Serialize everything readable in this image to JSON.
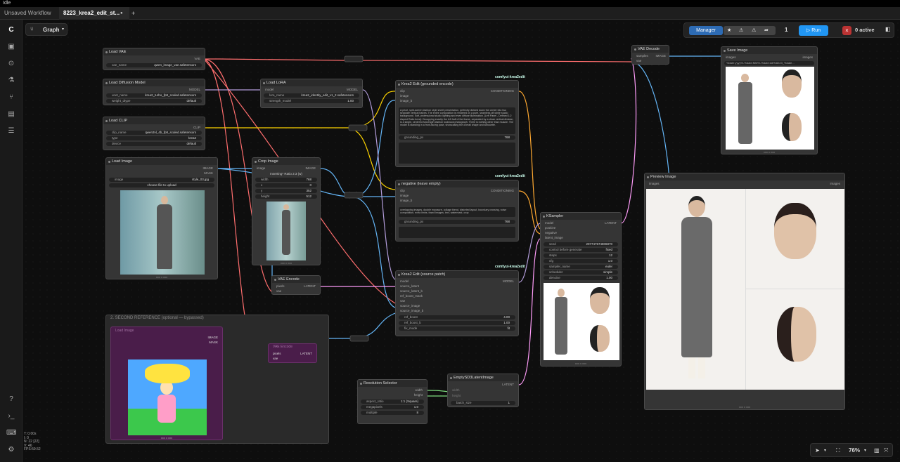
{
  "window_title": "Idle",
  "tabs": [
    {
      "label": "Unsaved Workflow"
    },
    {
      "label": "8223_krea2_edit_st..."
    }
  ],
  "tab_add_label": "+",
  "tab_dot": "●",
  "toolbar": {
    "graph_label": "Graph",
    "manager_label": "Manager",
    "queue_count": "1",
    "run_label": "Run",
    "active_label": "0 active"
  },
  "nodes": {
    "load_vae": {
      "title": "Load VAE",
      "out_vae": "VAE",
      "w_name": "vae_name",
      "w_value": "qwen_image_vae.safetensors"
    },
    "load_diffusion": {
      "title": "Load Diffusion Model",
      "out": "MODEL",
      "w1_name": "unet_name",
      "w1_value": "krea2_turbo_fp8_scaled.safetensors",
      "w2_name": "weight_dtype",
      "w2_value": "default"
    },
    "load_clip": {
      "title": "Load CLIP",
      "out": "CLIP",
      "w1_name": "clip_name",
      "w1_value": "qwen3vl_4b_fp8_scaled.safetensors",
      "w2_name": "type",
      "w2_value": "krea2",
      "w3_name": "device",
      "w3_value": "default"
    },
    "load_lora": {
      "title": "Load LoRA",
      "in": "model",
      "out": "MODEL",
      "w1_name": "lora_name",
      "w1_value": "krea2_identity_edit_v1_2.safetensors",
      "w2_name": "strength_model",
      "w2_value": "1.00"
    },
    "load_image": {
      "title": "Load Image",
      "out1": "IMAGE",
      "out2": "MASK",
      "w_name": "image",
      "w_value": "style_03.jpg",
      "upload_label": "choose file to upload",
      "caption": "xxx x xxx"
    },
    "crop_image": {
      "title": "Crop Image",
      "in": "image",
      "out": "IMAGE",
      "preset": "Inserting* Ratio 2:3 (w)",
      "w1": "width",
      "v1": "768",
      "w2": "x",
      "v2": "0",
      "w3": "y",
      "v3": "352",
      "w4": "height",
      "v4": "512",
      "caption": "xxx x xxx"
    },
    "vae_encode": {
      "title": "VAE Encode",
      "in1": "pixels",
      "in2": "vae",
      "out": "LATENT"
    },
    "krea_pos": {
      "tag": "comfyui-krea2edit",
      "title": "Krea2 Edit (grounded encode)",
      "in1": "clip",
      "in2": "image",
      "in3": "image_b",
      "out": "CONDITIONING",
      "text": "A priori, split-screen fashion style sheet presentation, perfectly divided down the center into two separate vertical halves. The entire composition is rendered on a pure, seamless off-white studio background. Soft, professional studio lighting and even diffuse illumination.\n\n[Left Panel - Defined 1:2 Aspect Ratio Area]: Occupying exactly the left half of the frame, separated by a clean vertical division, is a single, centered full-length fashion lookbook photograph. There is nothing other than muscle. The model is standing in a front-facing pose, showcasing the overall shape and silhouette.",
      "w_name": "grounding_px",
      "w_value": "768"
    },
    "krea_neg": {
      "tag": "comfyui-krea2edit",
      "title": "negative (leave empty)",
      "in1": "clip",
      "in2": "image",
      "in3": "image_b",
      "out": "CONDITIONING",
      "text": "overlapping images, double exposure, collage blend, distorted layout, boundary crossing, noise composition, extra limbs, fused images, text, watermark, crop",
      "w_name": "grounding_px",
      "w_value": "768"
    },
    "krea_src": {
      "tag": "comfyui-krea2edit",
      "title": "Krea2 Edit (source patch)",
      "in1": "model",
      "in2": "source_latent",
      "in3": "source_latent_b",
      "in4": "ref_boost_mask",
      "in5": "vae",
      "in6": "source_image",
      "in7": "source_image_b",
      "out": "MODEL",
      "w1": "ref_boost",
      "v1": "4.00",
      "w2": "ref_boost_b",
      "v2": "1.00",
      "w3": "fix_mode",
      "v3": "fit"
    },
    "ksampler": {
      "title": "KSampler",
      "in1": "model",
      "in2": "positive",
      "in3": "negative",
      "in4": "latent_image",
      "out": "LATENT",
      "w1": "seed",
      "v1": "207747574806870",
      "w2": "control before generate",
      "v2": "fixed",
      "w3": "steps",
      "v3": "12",
      "w4": "cfg",
      "v4": "1.0",
      "w5": "sampler_name",
      "v5": "euler",
      "w6": "scheduler",
      "v6": "simple",
      "w7": "denoise",
      "v7": "1.00",
      "caption": "xxx x xxx"
    },
    "vae_decode": {
      "title": "VAE Decode",
      "in1": "samples",
      "in2": "vae",
      "out": "IMAGE"
    },
    "save_image": {
      "title": "Save Image",
      "in": "images",
      "out": "images",
      "w_value": "%date:yyyy%-%date:MM%-%date:dd%/8223_%date...",
      "caption": "xxx x xxx"
    },
    "preview_image": {
      "title": "Preview Image",
      "in": "images",
      "out": "images",
      "caption": "xxx x xxx"
    },
    "resolution": {
      "title": "Resolution Selector",
      "out1": "width",
      "out2": "height",
      "w1": "aspect_ratio",
      "v1": "1:1 (Square)",
      "w2": "megapixels",
      "v2": "1.0",
      "w3": "multiple",
      "v3": "8"
    },
    "empty_latent": {
      "title": "EmptySD3LatentImage",
      "in1": "width",
      "in2": "height",
      "out": "LATENT",
      "w1": "batch_size",
      "v1": "1"
    },
    "group2": {
      "title": "2. SECOND REFERENCE (optional — bypassed)",
      "out1": "IMAGE",
      "out2": "MASK",
      "inner_title": "Load Image",
      "caption": "xxx x xxx"
    },
    "vae_encode2": {
      "title": "VAE Encode",
      "in1": "pixels",
      "in2": "vae",
      "out": "LATENT"
    }
  },
  "stats": [
    "T: 0.00s",
    "I: 0",
    "N: 22 [22]",
    "V: 46",
    "FPS:59.52"
  ],
  "zoom": {
    "value": "76%"
  },
  "colors": {
    "vae": "#ff6e6e",
    "model": "#b39ddb",
    "clip": "#ffd500",
    "image": "#64b5f6",
    "latent": "#ff9cf9",
    "conditioning": "#ffa931",
    "int": "#7fdc7f"
  },
  "icons": [
    "logo-icon",
    "images-icon",
    "nodes-icon",
    "models-icon",
    "workflows-icon",
    "templates-icon",
    "help-icon",
    "terminal-icon",
    "keyboard-icon",
    "settings-icon"
  ]
}
